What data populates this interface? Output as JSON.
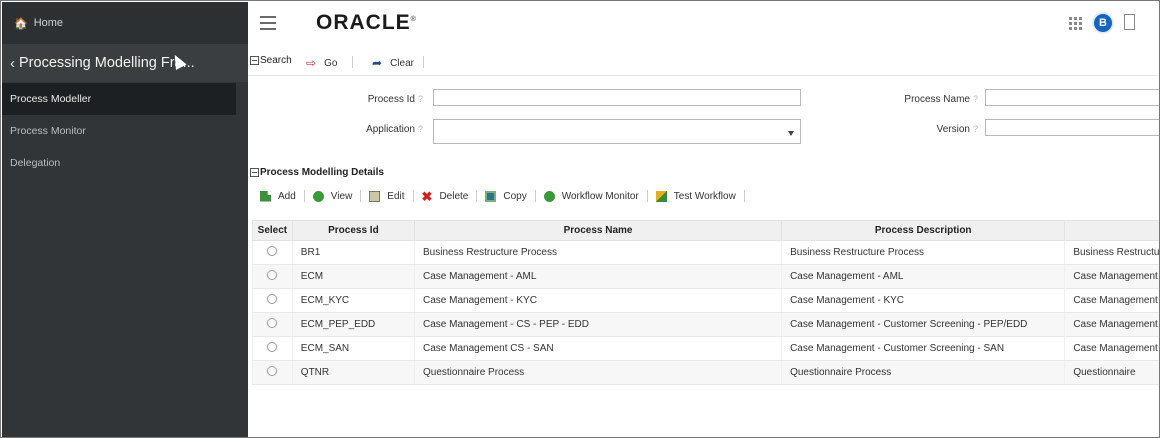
{
  "sidebar": {
    "home_label": "Home",
    "title": "Processing Modelling Fra...",
    "items": [
      {
        "label": "Process Modeller"
      },
      {
        "label": "Process Monitor"
      },
      {
        "label": "Delegation"
      }
    ]
  },
  "topbar": {
    "logo": "ORACLE",
    "avatar_letter": "B"
  },
  "search": {
    "section_label": "Search",
    "go_label": "Go",
    "clear_label": "Clear",
    "process_id_label": "Process Id",
    "process_id_value": "",
    "process_name_label": "Process Name",
    "process_name_value": "",
    "application_label": "Application",
    "application_value": "",
    "version_label": "Version",
    "version_value": "",
    "help_glyph": "?"
  },
  "details": {
    "section_label": "Process Modelling Details",
    "toolbar": {
      "add": "Add",
      "view": "View",
      "edit": "Edit",
      "delete": "Delete",
      "copy": "Copy",
      "workflow_monitor": "Workflow Monitor",
      "test_workflow": "Test Workflow"
    },
    "columns": [
      "Select",
      "Process Id",
      "Process Name",
      "Process Description",
      ""
    ],
    "rows": [
      {
        "id": "BR1",
        "name": "Business Restructure Process",
        "desc": "Business Restructure Process",
        "extra": "Business Restructu"
      },
      {
        "id": "ECM",
        "name": "Case Management - AML",
        "desc": "Case Management - AML",
        "extra": "Case Management"
      },
      {
        "id": "ECM_KYC",
        "name": "Case Management - KYC",
        "desc": "Case Management - KYC",
        "extra": "Case Management"
      },
      {
        "id": "ECM_PEP_EDD",
        "name": "Case Management - CS - PEP - EDD",
        "desc": "Case Management - Customer Screening - PEP/EDD",
        "extra": "Case Management"
      },
      {
        "id": "ECM_SAN",
        "name": "Case Management CS - SAN",
        "desc": "Case Management - Customer Screening - SAN",
        "extra": "Case Management"
      },
      {
        "id": "QTNR",
        "name": "Questionnaire Process",
        "desc": "Questionnaire Process",
        "extra": "Questionnaire"
      }
    ]
  },
  "colors": {
    "sidebar_bg": "#313538",
    "accent_blue": "#1565c0",
    "go_red": "#c0392b"
  },
  "icons": [
    "home-icon",
    "chevron-left-icon",
    "hamburger-menu-icon",
    "app-grid-icon",
    "user-avatar-icon",
    "document-icon",
    "go-arrow-icon",
    "clear-icon",
    "add-icon",
    "view-icon",
    "edit-icon",
    "delete-icon",
    "copy-icon",
    "workflow-monitor-icon",
    "test-workflow-icon"
  ]
}
